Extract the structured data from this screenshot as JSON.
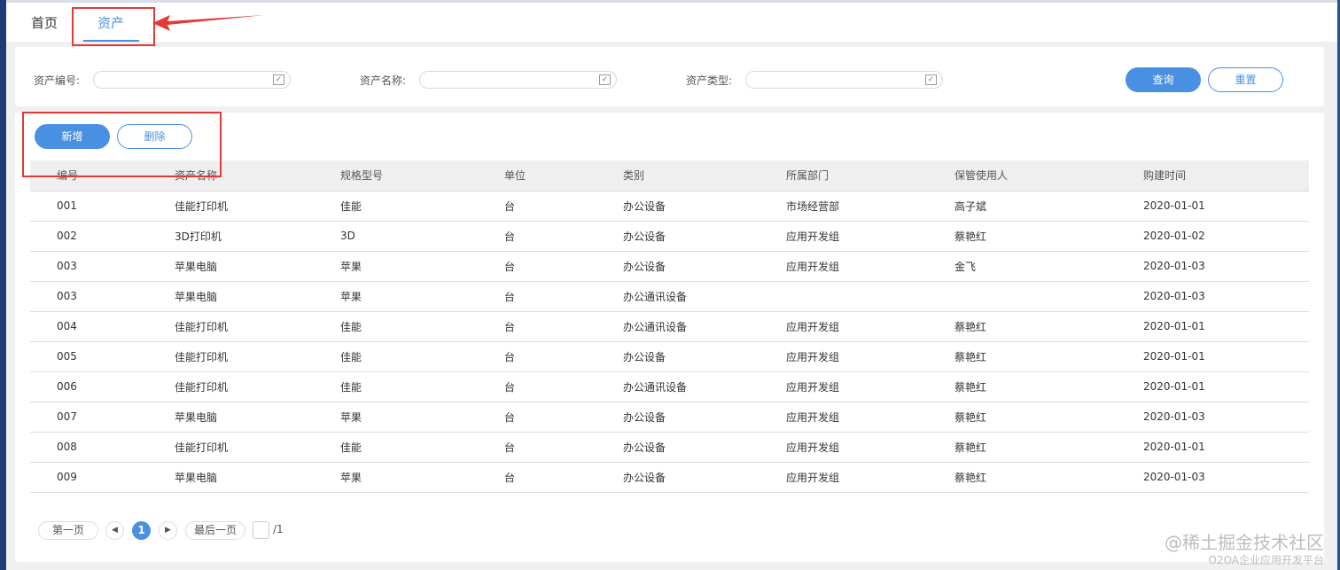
{
  "tabs": [
    {
      "label": "首页"
    },
    {
      "label": "资产"
    }
  ],
  "search": {
    "fields": [
      {
        "label": "资产编号:",
        "value": "",
        "placeholder": ""
      },
      {
        "label": "资产名称:",
        "value": "",
        "placeholder": ""
      },
      {
        "label": "资产类型:",
        "value": "",
        "placeholder": ""
      }
    ],
    "query_label": "查询",
    "reset_label": "重置"
  },
  "toolbar": {
    "add_label": "新增",
    "delete_label": "删除"
  },
  "table": {
    "headers": [
      "编号",
      "资产名称",
      "规格型号",
      "单位",
      "类别",
      "所属部门",
      "保管使用人",
      "购建时间"
    ],
    "rows": [
      [
        "001",
        "佳能打印机",
        "佳能",
        "台",
        "办公设备",
        "市场经营部",
        "高子斌",
        "2020-01-01"
      ],
      [
        "002",
        "3D打印机",
        "3D",
        "台",
        "办公设备",
        "应用开发组",
        "蔡艳红",
        "2020-01-02"
      ],
      [
        "003",
        "苹果电脑",
        "苹果",
        "台",
        "办公设备",
        "应用开发组",
        "金飞",
        "2020-01-03"
      ],
      [
        "003",
        "苹果电脑",
        "苹果",
        "台",
        "办公通讯设备",
        "",
        "",
        "2020-01-03"
      ],
      [
        "004",
        "佳能打印机",
        "佳能",
        "台",
        "办公通讯设备",
        "应用开发组",
        "蔡艳红",
        "2020-01-01"
      ],
      [
        "005",
        "佳能打印机",
        "佳能",
        "台",
        "办公设备",
        "应用开发组",
        "蔡艳红",
        "2020-01-01"
      ],
      [
        "006",
        "佳能打印机",
        "佳能",
        "台",
        "办公通讯设备",
        "应用开发组",
        "蔡艳红",
        "2020-01-01"
      ],
      [
        "007",
        "苹果电脑",
        "苹果",
        "台",
        "办公设备",
        "应用开发组",
        "蔡艳红",
        "2020-01-03"
      ],
      [
        "008",
        "佳能打印机",
        "佳能",
        "台",
        "办公设备",
        "应用开发组",
        "蔡艳红",
        "2020-01-01"
      ],
      [
        "009",
        "苹果电脑",
        "苹果",
        "台",
        "办公设备",
        "应用开发组",
        "蔡艳红",
        "2020-01-03"
      ]
    ]
  },
  "pagination": {
    "first_label": "第一页",
    "current_page": "1",
    "last_label": "最后一页",
    "total": "/1"
  },
  "watermark": {
    "line1": "@稀土掘金技术社区",
    "line2": "O2OA企业应用开发平台"
  },
  "colors": {
    "accent": "#4a90e2",
    "annotation": "#e53935"
  }
}
